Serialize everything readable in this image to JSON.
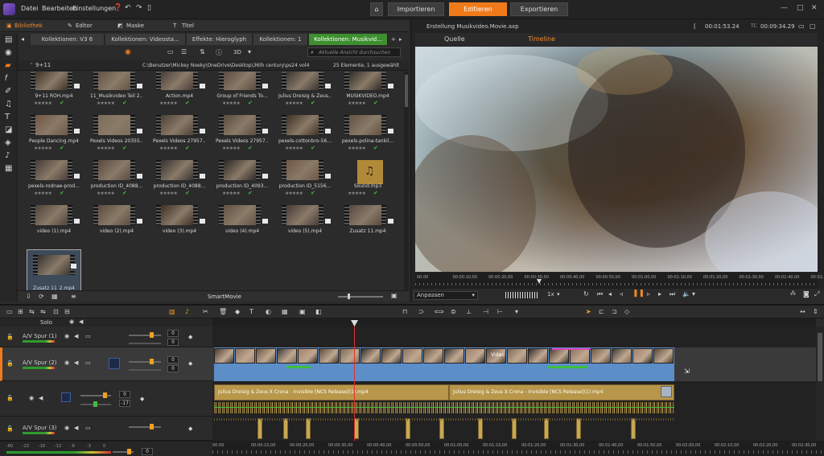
{
  "menubar": {
    "items": [
      "Datei",
      "Bearbeiten",
      "Einstellungen"
    ],
    "modes": [
      "Importieren",
      "Editieren",
      "Exportieren"
    ]
  },
  "library": {
    "tabs": [
      "Bibliothek",
      "Editor",
      "Maske",
      "Titel"
    ],
    "collection_tabs": [
      "Kollektionen: V3 6",
      "Kollektionen: Videosta...",
      "Effekte: Hieroglyph",
      "Kollektionen: 1",
      "Kollektionen: Musikvid..."
    ],
    "search_placeholder": "Aktuelle Ansicht durchsuchen",
    "folder_name": "9+11",
    "path": "C:\\Benutzer\\Mickey Noeky\\OneDrive\\Desktop\\36th century\\ps24 vol4",
    "count": "25 Elemente, 1 ausgewählt",
    "items": [
      "9+11 ROH.mp4",
      "11_Musikvideo Teil 2...",
      "Action.mp4",
      "Group of Friends To...",
      "Julius Dreisig & Zeus...",
      "MUSIKVIDEO.mp4",
      "People Dancing.mp4",
      "Pexels Videos 20355...",
      "Pexels Videos 27957...",
      "Pexels Videos 27957...",
      "pexels-cottonbro-56...",
      "pexels-polina-tankil...",
      "pexels-rodnae-prod...",
      "production ID_4088...",
      "production ID_4088...",
      "production ID_4093...",
      "production ID_5156...",
      "Sound.mp3",
      "video (1).mp4",
      "video (2).mp4",
      "video (3).mp4",
      "video (4).mp4",
      "video (5).mp4",
      "Zusatz 11.mp4",
      "Zusatz 11_2.mp4"
    ],
    "footer_label": "SmartMovie"
  },
  "preview": {
    "title": "Erstellung Musikvideo.Movie.axp",
    "timecode_left": "00:01:53.24",
    "tc_label": "TC",
    "timecode_right": "00:09:34.29",
    "tabs": [
      "Quelle",
      "Timeline"
    ],
    "ruler": [
      "00.00",
      "00:00:10,00",
      "00:00:20,00",
      "00:00:30,00",
      "00:00:40,00",
      "00:00:50,00",
      "00:01:00,00",
      "00:01:10,00",
      "00:01:20,00",
      "00:01:30,00",
      "00:01:40,00",
      "00:01:50,00"
    ],
    "fit_label": "Anpassen",
    "speed": "1x"
  },
  "timeline": {
    "solo_label": "Solo",
    "tracks": [
      "A/V Spur (1)",
      "A/V Spur (2)",
      "A/V Spur (3)"
    ],
    "track1_values": [
      "0",
      "0"
    ],
    "track2_values": [
      "0",
      "0"
    ],
    "audio_values": [
      "0",
      "-17"
    ],
    "video_label": "Video",
    "audio_clip_1": "Julius Dreisig & Zeus X Crona - Invisible [NCS Release](1).mp4",
    "audio_clip_2": "Julius Dreisig & Zeus X Crona - Invisible [NCS Release](1).mp4",
    "ruler": [
      "00:00",
      "00:00:10,00",
      "00:00:20,00",
      "00:00:30,00",
      "00:00:40,00",
      "00:00:50,00",
      "00:01:00,00",
      "00:01:10,00",
      "00:01:20,00",
      "00:01:30,00",
      "00:01:40,00",
      "00:01:50,00",
      "00:02:00,00",
      "00:02:10,00",
      "00:02:20,00",
      "00:02:30,00"
    ],
    "meter_scale": [
      "-60",
      "-22",
      "-16",
      "-12",
      "-6",
      "-3",
      "0"
    ],
    "master_value": "0"
  }
}
